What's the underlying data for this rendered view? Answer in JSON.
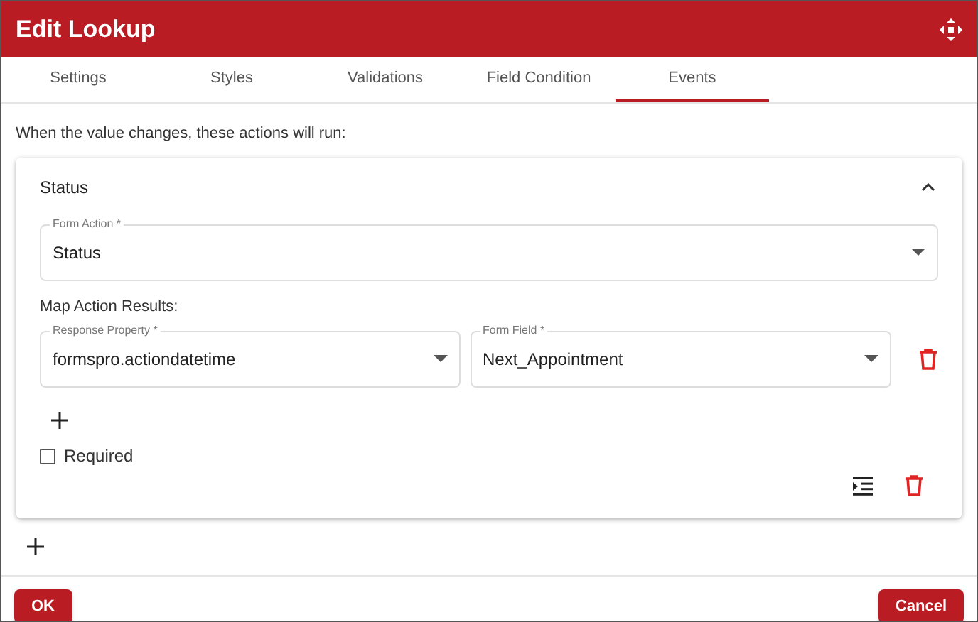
{
  "window": {
    "title": "Edit Lookup"
  },
  "tabs": [
    {
      "label": "Settings",
      "selected": false
    },
    {
      "label": "Styles",
      "selected": false
    },
    {
      "label": "Validations",
      "selected": false
    },
    {
      "label": "Field Condition",
      "selected": false
    },
    {
      "label": "Events",
      "selected": true
    }
  ],
  "intro": "When the value changes, these actions will run:",
  "action": {
    "title": "Status",
    "expanded": true,
    "form_action": {
      "label": "Form Action *",
      "value": "Status"
    },
    "map_label": "Map Action Results:",
    "mappings": [
      {
        "response_property": {
          "label": "Response Property *",
          "value": "formspro.actiondatetime"
        },
        "form_field": {
          "label": "Form Field *",
          "value": "Next_Appointment"
        }
      }
    ],
    "required": {
      "label": "Required",
      "checked": false
    }
  },
  "buttons": [
    {
      "label": "OK"
    },
    {
      "label": "Cancel"
    }
  ]
}
